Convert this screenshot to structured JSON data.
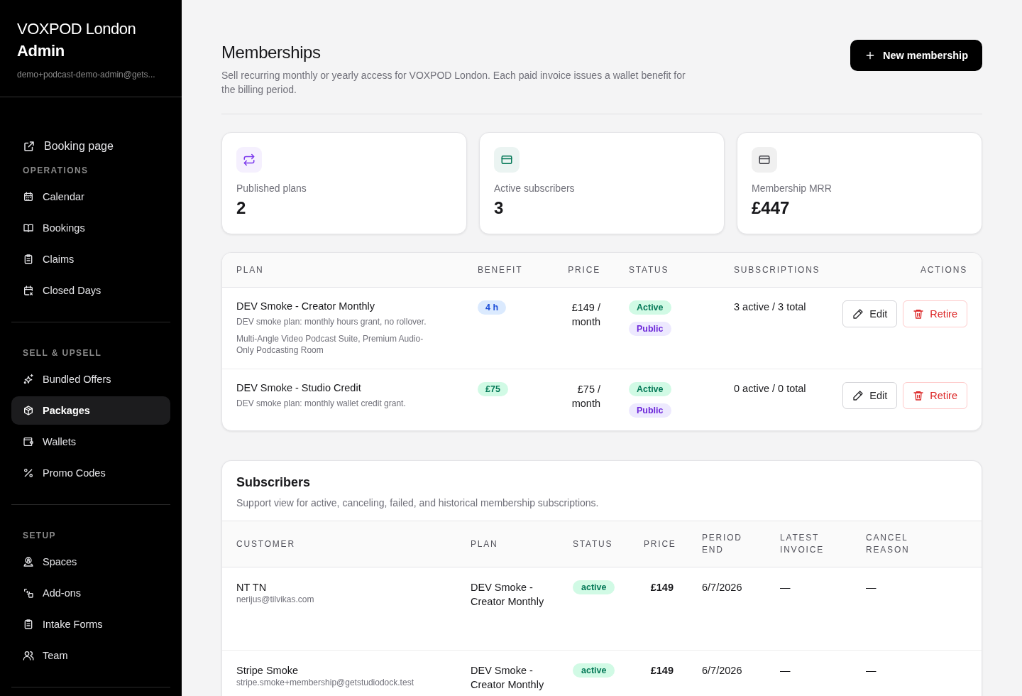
{
  "sidebar": {
    "brand": "VOXPOD London",
    "subtitle": "Admin",
    "email": "demo+podcast-demo-admin@gets...",
    "links": [
      {
        "label": "Booking page",
        "kind": "external"
      }
    ],
    "groups": [
      {
        "title": "OPERATIONS",
        "items": [
          {
            "label": "Calendar",
            "kind": "calendar",
            "selected": false
          },
          {
            "label": "Bookings",
            "kind": "book",
            "selected": false
          },
          {
            "label": "Claims",
            "kind": "clipboard",
            "selected": false
          },
          {
            "label": "Closed Days",
            "kind": "closure",
            "selected": false
          }
        ]
      },
      {
        "title": "SELL & UPSELL",
        "items": [
          {
            "label": "Bundled Offers",
            "kind": "sparkles",
            "selected": false
          },
          {
            "label": "Packages",
            "kind": "box",
            "selected": true
          },
          {
            "label": "Wallets",
            "kind": "wallet",
            "selected": false
          },
          {
            "label": "Promo Codes",
            "kind": "percent",
            "selected": false
          }
        ]
      },
      {
        "title": "SETUP",
        "items": [
          {
            "label": "Spaces",
            "kind": "space",
            "selected": false
          },
          {
            "label": "Add-ons",
            "kind": "shapes",
            "selected": false
          },
          {
            "label": "Intake Forms",
            "kind": "clipboard",
            "selected": false
          },
          {
            "label": "Team",
            "kind": "users",
            "selected": false
          }
        ]
      }
    ]
  },
  "header": {
    "title": "Memberships",
    "description": "Sell recurring monthly or yearly access for VOXPOD London. Each paid invoice issues a wallet benefit for the billing period.",
    "button": "New membership"
  },
  "stats": [
    {
      "label": "Published plans",
      "value": "2",
      "kind": "repeat",
      "color": "#7c3aed"
    },
    {
      "label": "Active subscribers",
      "value": "3",
      "kind": "card",
      "color": "#047857"
    },
    {
      "label": "Membership MRR",
      "value": "£447",
      "kind": "card",
      "color": "#3f3f46"
    }
  ],
  "plans": {
    "columns": [
      "PLAN",
      "BENEFIT",
      "PRICE",
      "STATUS",
      "SUBSCRIPTIONS",
      "ACTIONS"
    ],
    "rows": [
      {
        "name": "DEV Smoke - Creator Monthly",
        "description": "DEV smoke plan: monthly hours grant, no rollover.",
        "rooms": "Multi-Angle Video Podcast Suite, Premium Audio-Only Podcasting Room",
        "benefit": {
          "text": "4 h",
          "kind": "hours"
        },
        "price": "£149 / month",
        "badges": [
          {
            "label": "Active",
            "kind": "active"
          },
          {
            "label": "Public",
            "kind": "public"
          }
        ],
        "subscriptions": "3 active / 3 total",
        "actions": [
          {
            "label": "Edit",
            "kind": "edit"
          },
          {
            "label": "Retire",
            "kind": "retire"
          }
        ]
      },
      {
        "name": "DEV Smoke - Studio Credit",
        "description": "DEV smoke plan: monthly wallet credit grant.",
        "benefit": {
          "text": "£75",
          "kind": "credit"
        },
        "price": "£75 / month",
        "badges": [
          {
            "label": "Active",
            "kind": "active"
          },
          {
            "label": "Public",
            "kind": "public"
          }
        ],
        "subscriptions": "0 active / 0 total",
        "actions": [
          {
            "label": "Edit",
            "kind": "edit"
          },
          {
            "label": "Retire",
            "kind": "retire"
          }
        ]
      }
    ]
  },
  "subscribers": {
    "title": "Subscribers",
    "description": "Support view for active, canceling, failed, and historical membership subscriptions.",
    "columns": [
      "CUSTOMER",
      "PLAN",
      "STATUS",
      "PRICE",
      "PERIOD END",
      "LATEST INVOICE",
      "CANCEL REASON"
    ],
    "rows": [
      {
        "name": "NT TN",
        "email": "nerijus@tilvikas.com",
        "plan": "DEV Smoke - Creator Monthly",
        "status": "active",
        "price": "£149",
        "period_end": "6/7/2026",
        "latest_invoice": "—",
        "cancel_reason": "—"
      },
      {
        "name": "Stripe Smoke",
        "email": "stripe.smoke+membership@getstudiodock.test",
        "plan": "DEV Smoke - Creator Monthly",
        "status": "active",
        "price": "£149",
        "period_end": "6/7/2026",
        "latest_invoice": "—",
        "cancel_reason": "—"
      }
    ]
  }
}
